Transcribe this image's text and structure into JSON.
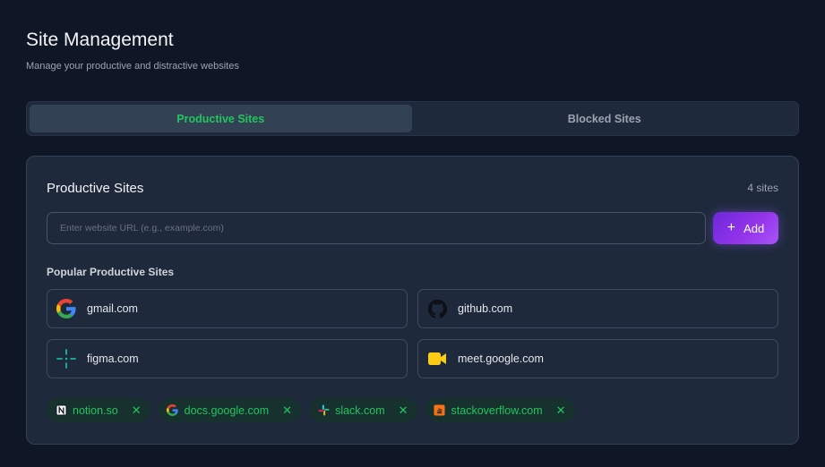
{
  "header": {
    "title": "Site Management",
    "subtitle": "Manage your productive and distractive websites"
  },
  "tabs": [
    {
      "label": "Productive Sites",
      "active": true
    },
    {
      "label": "Blocked Sites",
      "active": false
    }
  ],
  "card": {
    "title": "Productive Sites",
    "count": "4 sites",
    "input": {
      "value": "",
      "placeholder": "Enter website URL (e.g., example.com)"
    },
    "add_label": "Add",
    "popular_label": "Popular Productive Sites",
    "popular": [
      {
        "label": "gmail.com",
        "icon": "google-icon"
      },
      {
        "label": "github.com",
        "icon": "github-icon"
      },
      {
        "label": "figma.com",
        "icon": "figma-icon"
      },
      {
        "label": "meet.google.com",
        "icon": "google-meet-icon"
      }
    ],
    "chips": [
      {
        "label": "notion.so",
        "icon": "notion-icon"
      },
      {
        "label": "docs.google.com",
        "icon": "google-icon"
      },
      {
        "label": "slack.com",
        "icon": "slack-icon"
      },
      {
        "label": "stackoverflow.com",
        "icon": "stackoverflow-icon"
      }
    ]
  },
  "colors": {
    "background": "#0f1727",
    "card": "#1e293b",
    "accent_green": "#22c55e",
    "accent_purple": "#9333ea"
  }
}
